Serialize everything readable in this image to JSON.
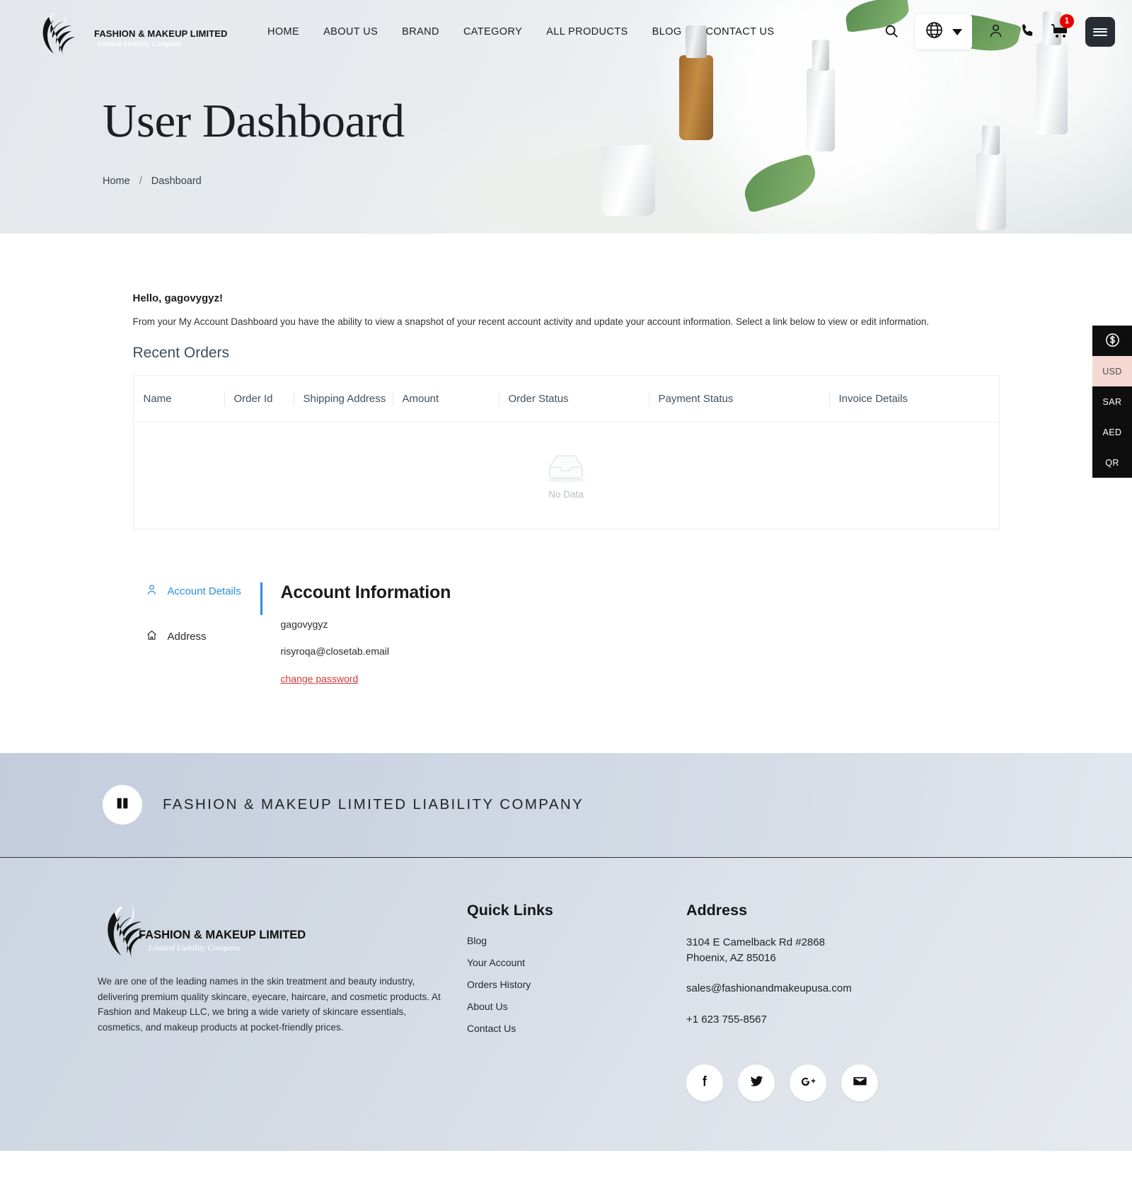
{
  "header": {
    "logo_text": "FASHION & MAKEUP LIMITED",
    "logo_sub": "Limited Liability Company",
    "nav": [
      {
        "label": "HOME"
      },
      {
        "label": "ABOUT US"
      },
      {
        "label": "BRAND"
      },
      {
        "label": "CATEGORY"
      },
      {
        "label": "ALL PRODUCTS"
      },
      {
        "label": "BLOG"
      },
      {
        "label": "CONTACT US"
      }
    ],
    "cart_badge": "1"
  },
  "hero": {
    "title": "User Dashboard",
    "breadcrumb_home": "Home",
    "breadcrumb_sep": "/",
    "breadcrumb_current": "Dashboard"
  },
  "dashboard": {
    "greeting": "Hello, gagovygyz!",
    "intro": "From your My Account Dashboard you have the ability to view a snapshot of your recent account activity and update your account information. Select a link below to view or edit information.",
    "recent_orders_title": "Recent Orders",
    "table": {
      "columns": [
        "Name",
        "Order Id",
        "Shipping Address",
        "Amount",
        "Order Status",
        "Payment Status",
        "Invoice Details"
      ],
      "rows": [],
      "empty_text": "No Data"
    }
  },
  "account": {
    "tabs": [
      {
        "label": "Account Details",
        "icon": "user-icon",
        "active": true
      },
      {
        "label": "Address",
        "icon": "home-icon",
        "active": false
      }
    ],
    "heading": "Account Information",
    "username": "gagovygyz",
    "email": "risyroqa@closetab.email",
    "change_password": "change password"
  },
  "currency_rail": {
    "items": [
      {
        "label": "USD",
        "active": true
      },
      {
        "label": "SAR",
        "active": false
      },
      {
        "label": "AED",
        "active": false
      },
      {
        "label": "QR",
        "active": false
      }
    ]
  },
  "footer_banner": {
    "text": "FASHION & MAKEUP LIMITED LIABILITY COMPANY"
  },
  "footer": {
    "logo_text": "FASHION & MAKEUP LIMITED",
    "logo_sub": "Limited Liability Company",
    "about": "We are one of the leading names in the skin treatment and beauty industry, delivering premium quality skincare, eyecare, haircare, and cosmetic products. At Fashion and Makeup LLC, we bring a wide variety of skincare essentials, cosmetics, and makeup products at pocket-friendly prices.",
    "quick_links_title": "Quick Links",
    "quick_links": [
      {
        "label": "Blog"
      },
      {
        "label": "Your Account"
      },
      {
        "label": "Orders History"
      },
      {
        "label": "About Us"
      },
      {
        "label": "Contact Us"
      }
    ],
    "address_title": "Address",
    "address_line1": "3104 E Camelback Rd #2868",
    "address_line2": "Phoenix, AZ 85016",
    "email": "sales@fashionandmakeupusa.com",
    "phone": "+1 623 755-8567",
    "socials": [
      {
        "name": "facebook-icon"
      },
      {
        "name": "twitter-icon"
      },
      {
        "name": "google-plus-icon"
      },
      {
        "name": "email-icon"
      }
    ]
  },
  "colors": {
    "accent_blue": "#2b8fe3",
    "link_red": "#cf3a3a",
    "badge_red": "#e80000",
    "rail_active": "#f5d8d2"
  }
}
